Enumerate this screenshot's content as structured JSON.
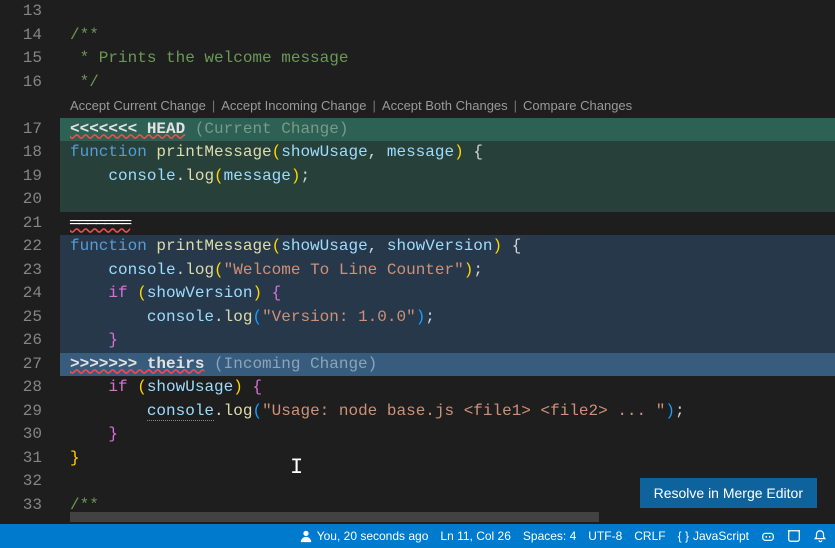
{
  "gutter": {
    "start": 13,
    "end": 33
  },
  "comment": {
    "open": "/**",
    "body": " * Prints the welcome message",
    "close": " */"
  },
  "codelens": {
    "accept_current": "Accept Current Change",
    "accept_incoming": "Accept Incoming Change",
    "accept_both": "Accept Both Changes",
    "compare": "Compare Changes"
  },
  "conflict": {
    "head_marker": "<<<<<<< HEAD",
    "head_label": "(Current Change)",
    "theirs_marker": ">>>>>>> theirs",
    "theirs_label": "(Incoming Change)"
  },
  "current": {
    "fn_keyword": "function",
    "fn_name": "printMessage",
    "param1": "showUsage",
    "param2": "message",
    "body_obj": "console",
    "body_method": "log",
    "body_arg": "message"
  },
  "incoming": {
    "fn_keyword": "function",
    "fn_name": "printMessage",
    "param1": "showUsage",
    "param2": "showVersion",
    "log1_obj": "console",
    "log1_method": "log",
    "log1_str": "\"Welcome To Line Counter\"",
    "if_kw": "if",
    "if_var": "showVersion",
    "log2_obj": "console",
    "log2_method": "log",
    "log2_str": "\"Version: 1.0.0\""
  },
  "after": {
    "if_kw": "if",
    "if_var": "showUsage",
    "log_obj": "console",
    "log_method": "log",
    "log_str": "\"Usage: node base.js <file1> <file2> ... \""
  },
  "trailing_comment": "/**",
  "resolve_button": "Resolve in Merge Editor",
  "status": {
    "blame": "You, 20 seconds ago",
    "cursor": "Ln 11, Col 26",
    "spaces": "Spaces: 4",
    "encoding": "UTF-8",
    "eol": "CRLF",
    "language": "JavaScript"
  }
}
